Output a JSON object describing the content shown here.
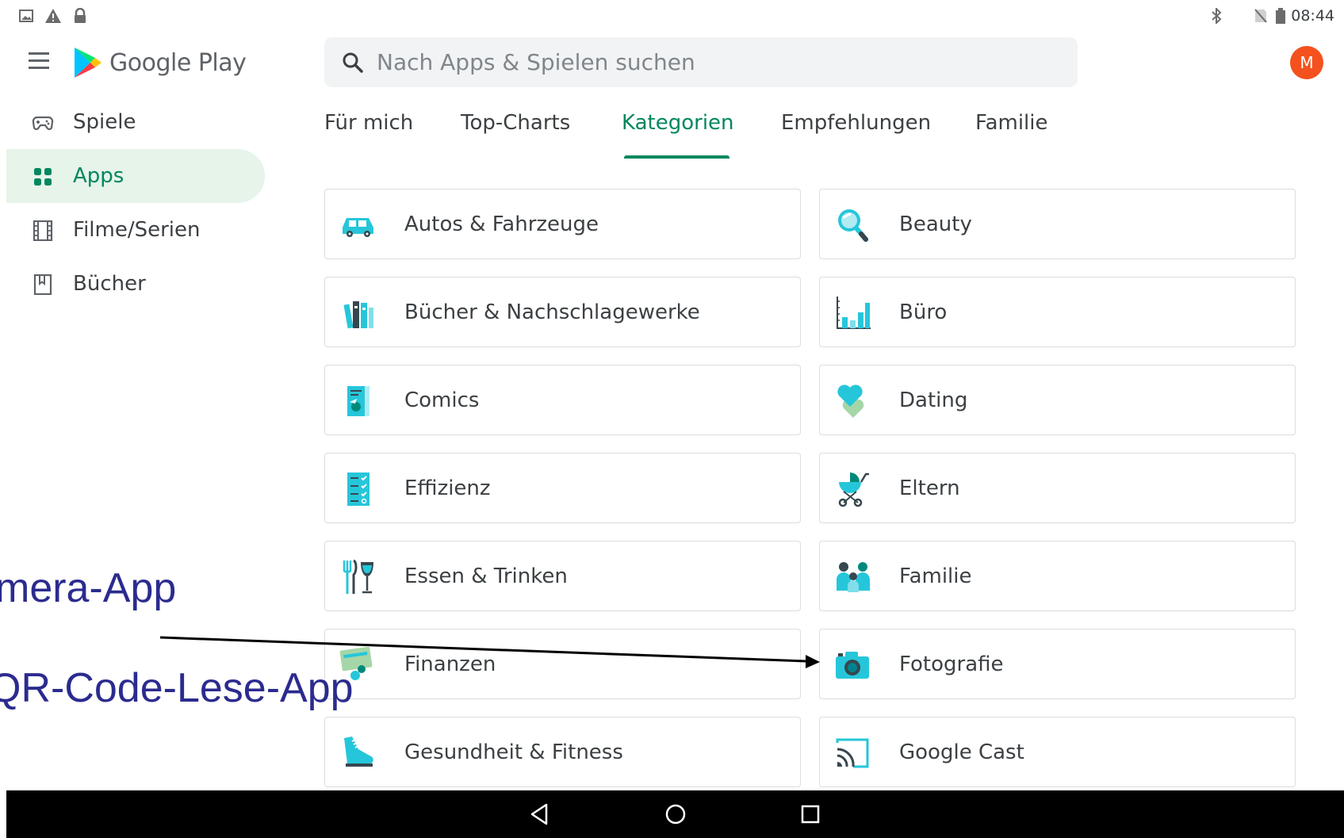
{
  "status_bar": {
    "time": "08:44",
    "icons": [
      "image-notification-icon",
      "warning-icon",
      "lock-icon",
      "bluetooth-icon",
      "no-sim-icon",
      "battery-icon"
    ]
  },
  "header": {
    "logo_text": "Google Play",
    "search_placeholder": "Nach Apps & Spielen suchen",
    "avatar_letter": "M",
    "avatar_color": "#f4511e"
  },
  "sidebar": {
    "items": [
      {
        "label": "Spiele",
        "icon": "gamepad-icon",
        "active": false
      },
      {
        "label": "Apps",
        "icon": "apps-grid-icon",
        "active": true
      },
      {
        "label": "Filme/Serien",
        "icon": "film-icon",
        "active": false
      },
      {
        "label": "Bücher",
        "icon": "bookmark-book-icon",
        "active": false
      }
    ]
  },
  "tabs": [
    {
      "label": "Für mich",
      "active": false
    },
    {
      "label": "Top-Charts",
      "active": false
    },
    {
      "label": "Kategorien",
      "active": true
    },
    {
      "label": "Empfehlungen",
      "active": false
    },
    {
      "label": "Familie",
      "active": false
    }
  ],
  "categories": [
    {
      "label": "Autos & Fahrzeuge",
      "icon": "car-icon"
    },
    {
      "label": "Beauty",
      "icon": "beauty-mirror-icon"
    },
    {
      "label": "Bücher & Nachschlagewerke",
      "icon": "books-icon"
    },
    {
      "label": "Büro",
      "icon": "bar-chart-icon"
    },
    {
      "label": "Comics",
      "icon": "comic-icon"
    },
    {
      "label": "Dating",
      "icon": "hearts-icon"
    },
    {
      "label": "Effizienz",
      "icon": "checklist-icon"
    },
    {
      "label": "Eltern",
      "icon": "stroller-icon"
    },
    {
      "label": "Essen & Trinken",
      "icon": "fork-wine-icon"
    },
    {
      "label": "Familie",
      "icon": "family-icon"
    },
    {
      "label": "Finanzen",
      "icon": "credit-card-icon"
    },
    {
      "label": "Fotografie",
      "icon": "camera-icon"
    },
    {
      "label": "Gesundheit & Fitness",
      "icon": "sneaker-icon"
    },
    {
      "label": "Google Cast",
      "icon": "cast-icon"
    }
  ],
  "annotations": {
    "line1": "mera-App",
    "line2": "QR-Code-Lese-App"
  },
  "colors": {
    "accent": "#01875f",
    "active_bg": "#e6f4ea",
    "icon_teal": "#26c6da",
    "annotation": "#2b2b8f"
  }
}
